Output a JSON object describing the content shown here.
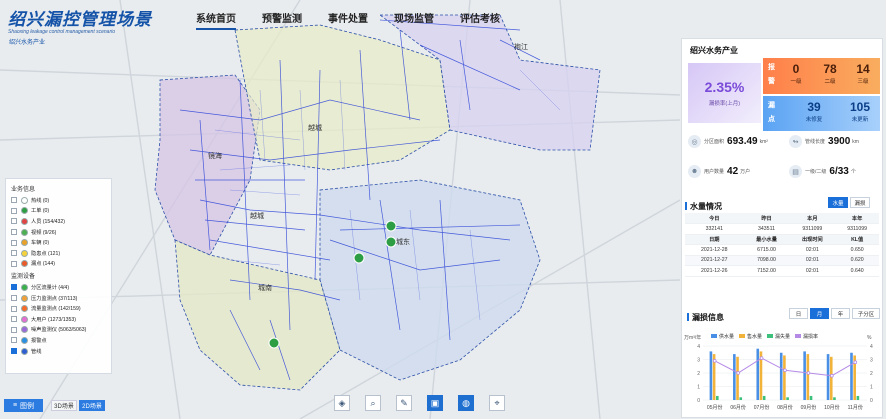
{
  "header": {
    "title": "绍兴漏控管理场景",
    "subtitle_en": "Shaoxing leakage control management scenario",
    "org": "绍兴水务产业",
    "nav": [
      "系统首页",
      "预警监测",
      "事件处置",
      "现场监管",
      "评估考核"
    ],
    "active_nav": 0
  },
  "map_labels": [
    "镜海",
    "越城",
    "城东",
    "城南",
    "袍江",
    "越城"
  ],
  "legend": {
    "section1": "业务信息",
    "items1": [
      {
        "label": "热线 (0)",
        "color": "#ffffff",
        "checked": false
      },
      {
        "label": "工单 (0)",
        "color": "#2e9e45",
        "checked": false
      },
      {
        "label": "人员 (154/432)",
        "color": "#e04545",
        "checked": false
      },
      {
        "label": "视频 (9/26)",
        "color": "#4caf50",
        "checked": false
      },
      {
        "label": "车辆 (0)",
        "color": "#e8a22a",
        "checked": false
      },
      {
        "label": "隐患点 (121)",
        "color": "#f5d23a",
        "checked": false
      },
      {
        "label": "漏点 (144)",
        "color": "#e85a2a",
        "checked": false
      }
    ],
    "section2": "监测设备",
    "items2": [
      {
        "label": "分区流量计 (4/4)",
        "color": "#3cb04a",
        "checked": true
      },
      {
        "label": "压力监测点 (37/113)",
        "color": "#f0a037",
        "checked": false
      },
      {
        "label": "流量监测点 (142/159)",
        "color": "#f56b2a",
        "checked": false
      },
      {
        "label": "大用户 (1273/1353)",
        "color": "#e36fd2",
        "checked": false
      },
      {
        "label": "噪声监测仪 (5063/5063)",
        "color": "#9a6ad8",
        "checked": false
      },
      {
        "label": "报警点",
        "color": "#2a8fe0",
        "checked": false
      },
      {
        "label": "管线",
        "color": "#2d5fd0",
        "checked": true
      }
    ]
  },
  "bottom": {
    "legend_btn": "图例",
    "btn3d": "3D场景",
    "btn2d": "2D场景"
  },
  "panel": {
    "title": "绍兴水务产业",
    "leak_rate": "2.35%",
    "leak_rate_label": "漏损率(上月)",
    "warn_label": "报警",
    "warn": [
      {
        "n": "0",
        "c": "一级"
      },
      {
        "n": "78",
        "c": "二级"
      },
      {
        "n": "14",
        "c": "三级"
      }
    ],
    "pts_label": "漏点",
    "pts": [
      {
        "n": "39",
        "c": "未修复"
      },
      {
        "n": "105",
        "c": "未更新"
      }
    ],
    "stats": [
      {
        "label": "分区面积",
        "value": "693.49",
        "unit": "km²"
      },
      {
        "label": "管线长度",
        "value": "3900",
        "unit": "km"
      },
      {
        "label": "用户数量",
        "value": "42",
        "unit": "万户"
      },
      {
        "label": "一级/二级",
        "value": "6/33",
        "unit": "个"
      }
    ]
  },
  "water": {
    "title": "水量情况",
    "tabs": [
      "水量",
      "漏损"
    ],
    "head1": [
      "今日",
      "昨日",
      "本月",
      "本年"
    ],
    "row1": [
      "332141",
      "343511",
      "9311099",
      "9311099"
    ],
    "head2": [
      "日期",
      "最小水量",
      "出现时间",
      "KL值"
    ],
    "rows": [
      [
        "2021-12-28",
        "6715.00",
        "02:01",
        "0.650"
      ],
      [
        "2021-12-27",
        "7098.00",
        "02:01",
        "0.620"
      ],
      [
        "2021-12-26",
        "7152.00",
        "02:01",
        "0.640"
      ]
    ]
  },
  "leak_info": {
    "title": "漏损信息",
    "tabs": [
      "日",
      "月",
      "年",
      "子分区"
    ],
    "active_tab": 1,
    "unit_left": "万m³/年",
    "unit_right": "%",
    "legend": [
      "供水量",
      "售水量",
      "漏失量",
      "漏损率"
    ]
  },
  "chart_data": {
    "type": "bar",
    "categories": [
      "05月份",
      "06月份",
      "07月份",
      "08月份",
      "09月份",
      "10月份",
      "11月份"
    ],
    "series": [
      {
        "name": "供水量",
        "color": "#4a8fe6",
        "values": [
          3.6,
          3.4,
          3.8,
          3.5,
          3.6,
          3.4,
          3.5
        ]
      },
      {
        "name": "售水量",
        "color": "#f2b33a",
        "values": [
          3.4,
          3.2,
          3.6,
          3.3,
          3.4,
          3.2,
          3.3
        ]
      },
      {
        "name": "漏失量",
        "color": "#3cc07a",
        "values": [
          0.3,
          0.2,
          0.3,
          0.2,
          0.3,
          0.2,
          0.3
        ]
      }
    ],
    "line": {
      "name": "漏损率",
      "color": "#b58ae6",
      "values": [
        2.9,
        2.0,
        3.1,
        2.2,
        2.0,
        1.8,
        2.8
      ]
    },
    "ylim": [
      0,
      4
    ],
    "y2lim": [
      0,
      4
    ]
  }
}
